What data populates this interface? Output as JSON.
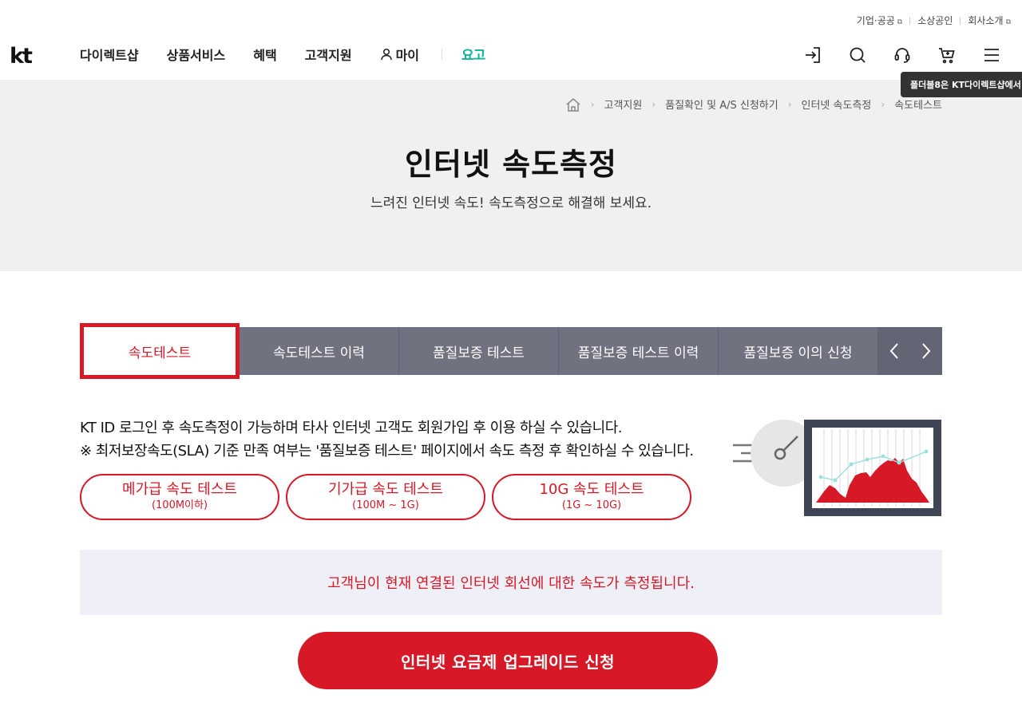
{
  "utility": {
    "links": [
      "기업·공공",
      "소상공인",
      "회사소개"
    ]
  },
  "logo": {
    "text": "kt"
  },
  "gnb": {
    "items": [
      "다이렉트샵",
      "상품서비스",
      "혜택",
      "고객지원",
      "마이"
    ],
    "yogo": "요고"
  },
  "tools": {
    "icons": [
      "login-icon",
      "search-icon",
      "headset-icon",
      "cart-icon",
      "menu-icon"
    ]
  },
  "tooltip": {
    "text": "폴더블8은 KT다이렉트샵에서"
  },
  "breadcrumb": [
    "고객지원",
    "품질확인 및 A/S 신청하기",
    "인터넷 속도측정",
    "속도테스트"
  ],
  "hero": {
    "title": "인터넷 속도측정",
    "subtitle": "느려진 인터넷 속도! 속도측정으로 해결해 보세요."
  },
  "tabs": {
    "items": [
      "속도테스트",
      "속도테스트 이력",
      "품질보증 테스트",
      "품질보증 테스트 이력",
      "품질보증 이의 신청"
    ],
    "active_index": 0
  },
  "info": {
    "line1": "KT ID 로그인 후 속도측정이 가능하며 타사 인터넷 고객도 회원가입 후 이용 하실 수 있습니다.",
    "line2": "※ 최저보장속도(SLA) 기준 만족 여부는 '품질보증 테스트' 페이지에서 속도 측정 후 확인하실 수 있습니다."
  },
  "tests": [
    {
      "label": "메가급 속도 테스트",
      "range": "(100M이하)"
    },
    {
      "label": "기가급 속도 테스트",
      "range": "(100M ~ 1G)"
    },
    {
      "label": "10G 속도 테스트",
      "range": "(1G ~ 10G)"
    }
  ],
  "notice": "고객님이 현재 연결된 인터넷 회선에 대한 속도가 측정됩니다.",
  "upgrade_button": "인터넷 요금제 업그레이드 신청",
  "colors": {
    "accent": "#d71826",
    "tab_bg": "#707280",
    "hero_bg": "#f0f0f0",
    "notice_bg": "#eff0f7",
    "yogo": "#10b496"
  }
}
